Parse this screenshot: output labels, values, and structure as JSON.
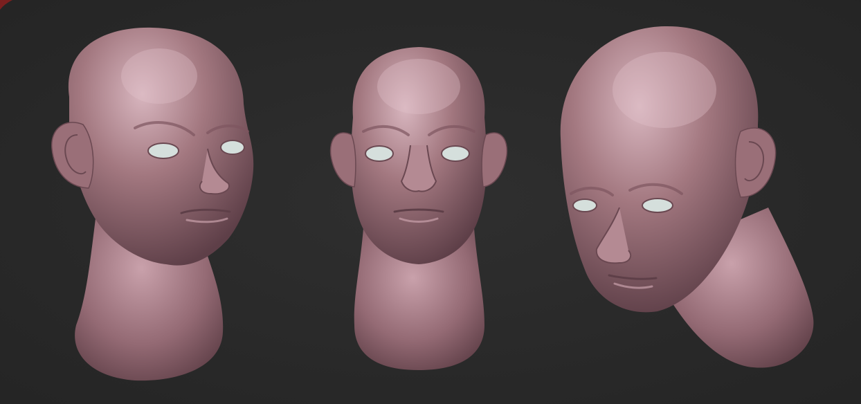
{
  "scene": {
    "background_color": "#2b2b2b",
    "material": {
      "skin_base": "#a37880",
      "skin_highlight": "#d8b6bf",
      "skin_shadow": "#5e3f48",
      "eye_color": "#d5dfdc"
    },
    "models": [
      {
        "view": "three-quarter-left"
      },
      {
        "view": "front"
      },
      {
        "view": "three-quarter-down-right"
      }
    ]
  }
}
